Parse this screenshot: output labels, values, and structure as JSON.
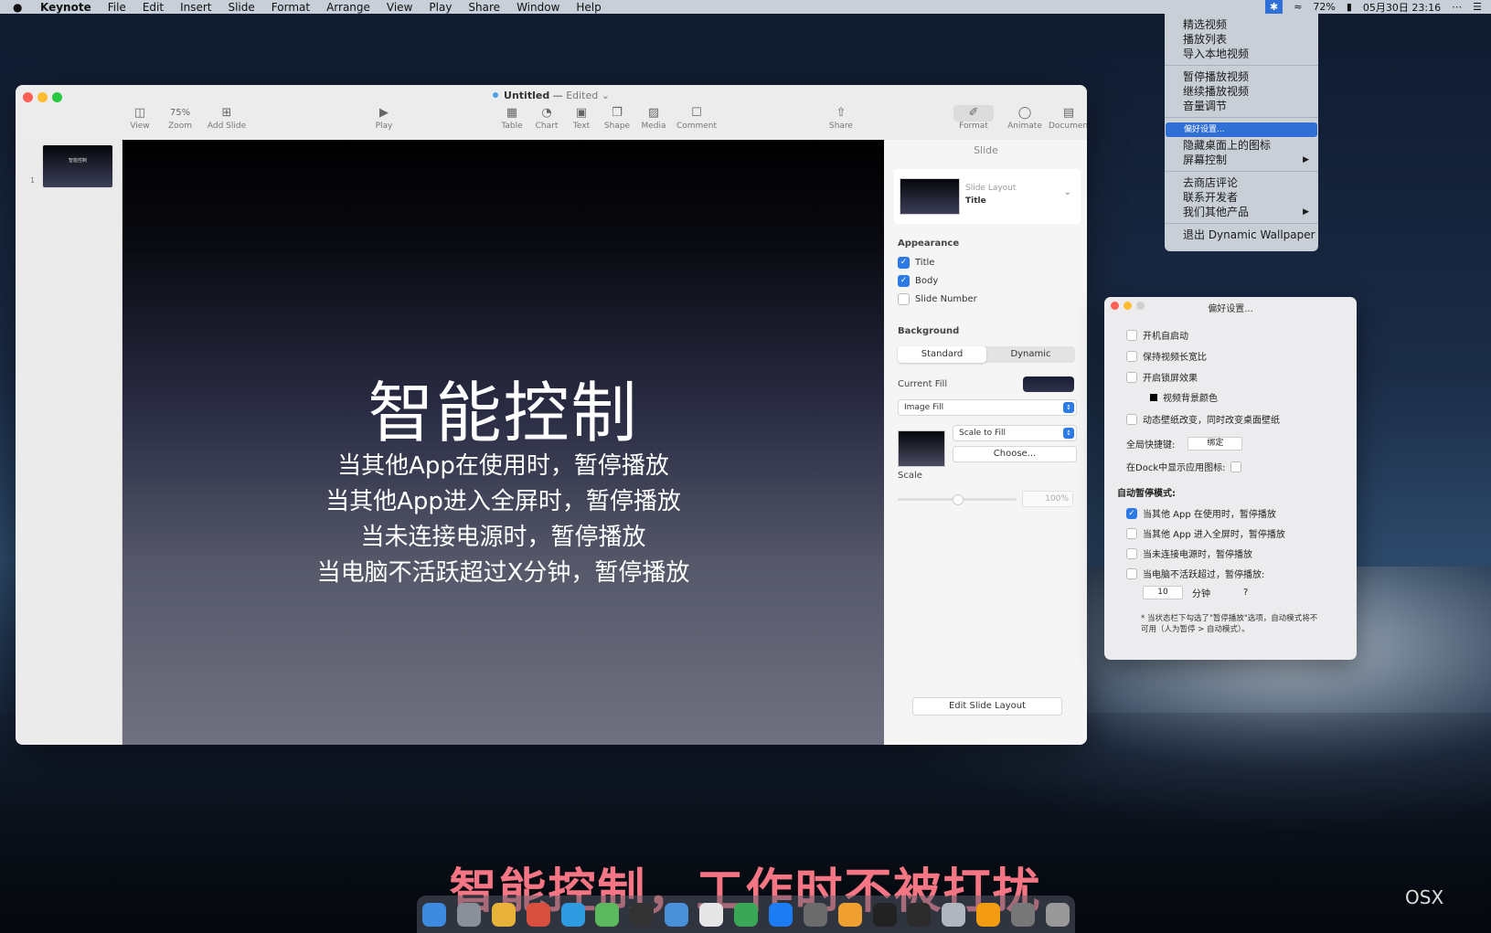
{
  "menubar": {
    "apple": "",
    "app": "Keynote",
    "items": [
      "File",
      "Edit",
      "Insert",
      "Slide",
      "Format",
      "Arrange",
      "View",
      "Play",
      "Share",
      "Window",
      "Help"
    ],
    "status": {
      "battery": "72%",
      "datetime": "05月30日 23:16"
    }
  },
  "status_menu": {
    "group1": [
      "精选视频",
      "播放列表",
      "导入本地视频"
    ],
    "group2": [
      "暂停播放视频",
      "继续播放视频",
      "音量调节"
    ],
    "group3": [
      "偏好设置...",
      "隐藏桌面上的图标",
      "屏幕控制"
    ],
    "group4": [
      "去商店评论",
      "联系开发者",
      "我们其他产品"
    ],
    "quit": "退出 Dynamic Wallpaper"
  },
  "keynote": {
    "title": "Untitled",
    "separator": "—",
    "edited": "Edited",
    "toolbar": {
      "view": "View",
      "zoom_value": "75%",
      "zoom": "Zoom",
      "add_slide": "Add Slide",
      "play": "Play",
      "table": "Table",
      "chart": "Chart",
      "text": "Text",
      "shape": "Shape",
      "media": "Media",
      "comment": "Comment",
      "share": "Share",
      "format": "Format",
      "animate": "Animate",
      "document": "Document"
    },
    "slide_number": "1",
    "slide": {
      "title": "智能控制",
      "body": [
        "当其他App在使用时，暂停播放",
        "当其他App进入全屏时，暂停播放",
        "当未连接电源时，暂停播放",
        "当电脑不活跃超过X分钟，暂停播放"
      ]
    },
    "inspector": {
      "tab": "Slide",
      "layout_label": "Slide Layout",
      "layout_value": "Title",
      "appearance": "Appearance",
      "opt_title": "Title",
      "opt_body": "Body",
      "opt_slide_number": "Slide Number",
      "background": "Background",
      "standard": "Standard",
      "dynamic": "Dynamic",
      "current_fill": "Current Fill",
      "fill_type": "Image Fill",
      "scale_mode": "Scale to Fill",
      "choose": "Choose...",
      "scale": "Scale",
      "scale_value": "100%",
      "edit_layout": "Edit Slide Layout"
    }
  },
  "prefs": {
    "title": "偏好设置...",
    "launch": "开机自启动",
    "keep_ratio": "保持视频长宽比",
    "lock_effect": "开启锁屏效果",
    "bg_color": "视频背景颜色",
    "change_desktop": "动态壁纸改变，同时改变桌面壁纸",
    "shortcut_label": "全局快捷键:",
    "shortcut_btn": "绑定",
    "dock_icon": "在Dock中显示应用图标:",
    "auto_pause": "自动暂停模式:",
    "pause_app": "当其他 App 在使用时，暂停播放",
    "pause_fullscreen": "当其他 App 进入全屏时，暂停播放",
    "pause_power": "当未连接电源时，暂停播放",
    "pause_idle": "当电脑不活跃超过，暂停播放:",
    "idle_value": "10",
    "idle_unit": "分钟",
    "help": "?",
    "note": "* 当状态栏下勾选了\"暂停播放\"选项，自动模式将不可用（人为暂停 > 自动模式）。"
  },
  "subtitle": "智能控制，工作时不被打扰",
  "watermark": "OSX"
}
